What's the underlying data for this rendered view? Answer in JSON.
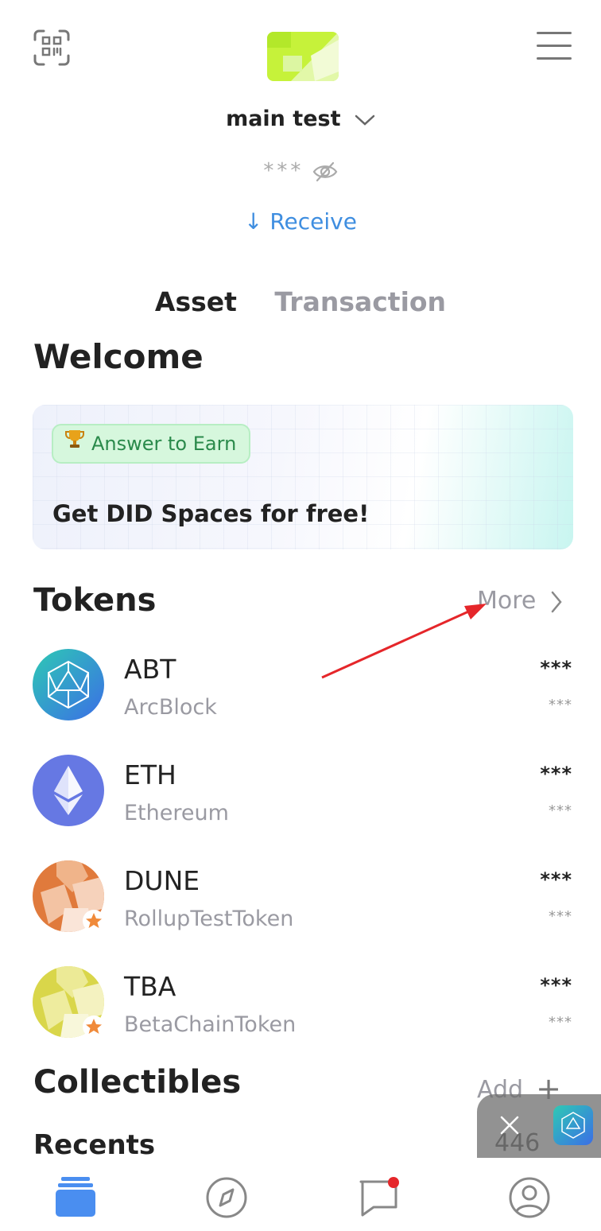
{
  "header": {
    "account_name": "main test",
    "balance_masked": "***",
    "receive_label": "↓ Receive",
    "icons": [
      "qr-scan-icon",
      "app-logo",
      "menu-icon"
    ]
  },
  "tabs": [
    {
      "label": "Asset",
      "active": true
    },
    {
      "label": "Transaction",
      "active": false
    }
  ],
  "welcome": {
    "title": "Welcome",
    "badge": "Answer to Earn",
    "banner_text": "Get DID Spaces for free!"
  },
  "tokens": {
    "title": "Tokens",
    "more_label": "More",
    "items": [
      {
        "symbol": "ABT",
        "name": "ArcBlock",
        "amount": "***",
        "fiat": "***"
      },
      {
        "symbol": "ETH",
        "name": "Ethereum",
        "amount": "***",
        "fiat": "***"
      },
      {
        "symbol": "DUNE",
        "name": "RollupTestToken",
        "amount": "***",
        "fiat": "***"
      },
      {
        "symbol": "TBA",
        "name": "BetaChainToken",
        "amount": "***",
        "fiat": "***"
      }
    ]
  },
  "collectibles": {
    "title": "Collectibles",
    "add_label": "Add",
    "recents_label": "Recents",
    "recents_count": "446"
  },
  "colors": {
    "accent": "#3f8ee0",
    "annotation_arrow": "#e5262a",
    "notification_dot": "#e5262a"
  },
  "bottom_nav": [
    "wallet-icon",
    "explore-compass-icon",
    "messages-icon",
    "profile-icon"
  ]
}
